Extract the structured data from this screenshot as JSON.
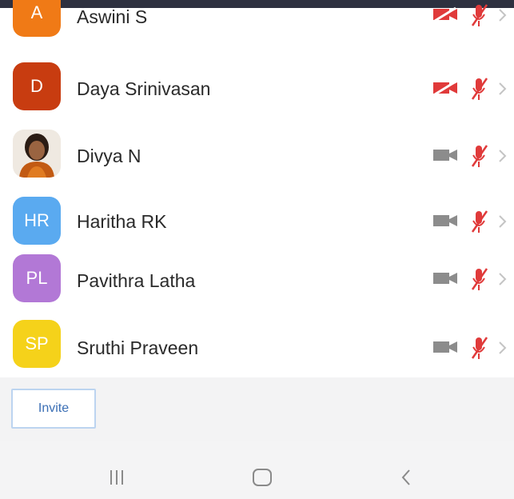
{
  "participants": [
    {
      "initials": "A",
      "name": "Aswini S",
      "avatar_color": "#f07a16",
      "video_muted_red": true,
      "audio_muted": true
    },
    {
      "initials": "D",
      "name": "Daya Srinivasan",
      "avatar_color": "#c83c10",
      "video_muted_red": true,
      "audio_muted": true
    },
    {
      "initials": "",
      "name": "Divya N",
      "avatar_photo": true,
      "video_muted_red": false,
      "audio_muted": true
    },
    {
      "initials": "HR",
      "name": "Haritha RK",
      "avatar_color": "#5aaaf0",
      "video_muted_red": false,
      "audio_muted": true
    },
    {
      "initials": "PL",
      "name": "Pavithra Latha",
      "avatar_color": "#b278d6",
      "video_muted_red": false,
      "audio_muted": true
    },
    {
      "initials": "SP",
      "name": "Sruthi Praveen",
      "avatar_color": "#f5d21a",
      "video_muted_red": false,
      "audio_muted": true
    }
  ],
  "footer": {
    "invite_label": "Invite"
  },
  "colors": {
    "muted_red": "#e03a3a",
    "camera_gray": "#8c8c8c",
    "chevron_gray": "#c4c4c4"
  },
  "icons": [
    "camera-icon",
    "mic-muted-icon",
    "chevron-right-icon",
    "recent-apps-icon",
    "home-icon",
    "back-icon"
  ]
}
